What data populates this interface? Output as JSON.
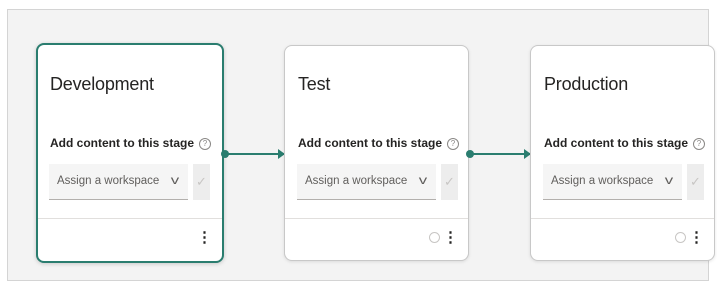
{
  "stages": [
    {
      "title": "Development",
      "add_content_label": "Add content to this stage",
      "info_glyph": "?",
      "workspace_placeholder": "Assign a workspace",
      "chevron_glyph": "v",
      "check_glyph": "✓",
      "more_glyph": "⋮",
      "selected": true
    },
    {
      "title": "Test",
      "add_content_label": "Add content to this stage",
      "info_glyph": "?",
      "workspace_placeholder": "Assign a workspace",
      "chevron_glyph": "v",
      "check_glyph": "✓",
      "more_glyph": "⋮",
      "selected": false
    },
    {
      "title": "Production",
      "add_content_label": "Add content to this stage",
      "info_glyph": "?",
      "workspace_placeholder": "Assign a workspace",
      "chevron_glyph": "v",
      "check_glyph": "✓",
      "more_glyph": "⋮",
      "selected": false
    }
  ],
  "icons": {
    "info": "info-icon",
    "chevron": "chevron-down-icon",
    "check": "checkmark-icon",
    "more": "more-options-icon",
    "deploy": "deploy-icon",
    "connector": "connector-arrow"
  },
  "colors": {
    "accent": "#2a7d6f",
    "card_border": "#c8c8c8",
    "background": "#f3f3f3"
  }
}
